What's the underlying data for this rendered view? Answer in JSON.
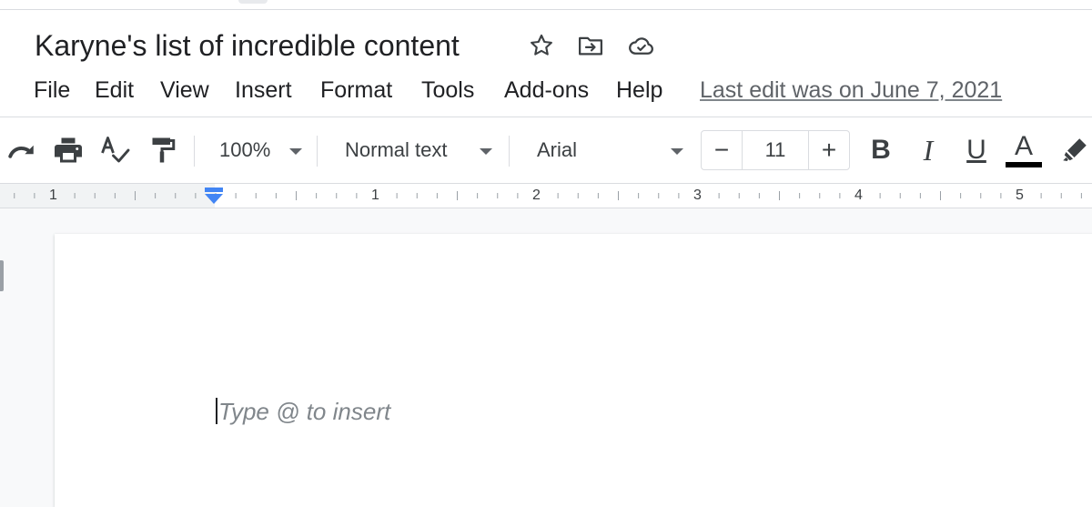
{
  "document": {
    "title": "Karyne's list of incredible content",
    "title_icons": [
      "star-icon",
      "move-to-folder-icon",
      "cloud-saved-icon"
    ]
  },
  "menu": {
    "items": [
      "File",
      "Edit",
      "View",
      "Insert",
      "Format",
      "Tools",
      "Add-ons",
      "Help"
    ],
    "last_edit": "Last edit was on June 7, 2021"
  },
  "toolbar": {
    "icons": [
      "redo-icon",
      "print-icon",
      "spellcheck-icon",
      "paint-format-icon"
    ],
    "zoom": "100%",
    "style": "Normal text",
    "font": "Arial",
    "font_size": "11",
    "decrease_label": "−",
    "increase_label": "+",
    "bold": "B",
    "italic": "I",
    "underline": "U",
    "text_color": "A",
    "text_color_value": "#000000"
  },
  "ruler": {
    "labels": [
      "1",
      "1",
      "2",
      "3",
      "4",
      "5"
    ]
  },
  "editor": {
    "placeholder": "Type @ to insert"
  },
  "colors": {
    "background": "#f8f9fa",
    "text": "#202124",
    "muted": "#5f6368",
    "indent_marker": "#4285f4"
  }
}
